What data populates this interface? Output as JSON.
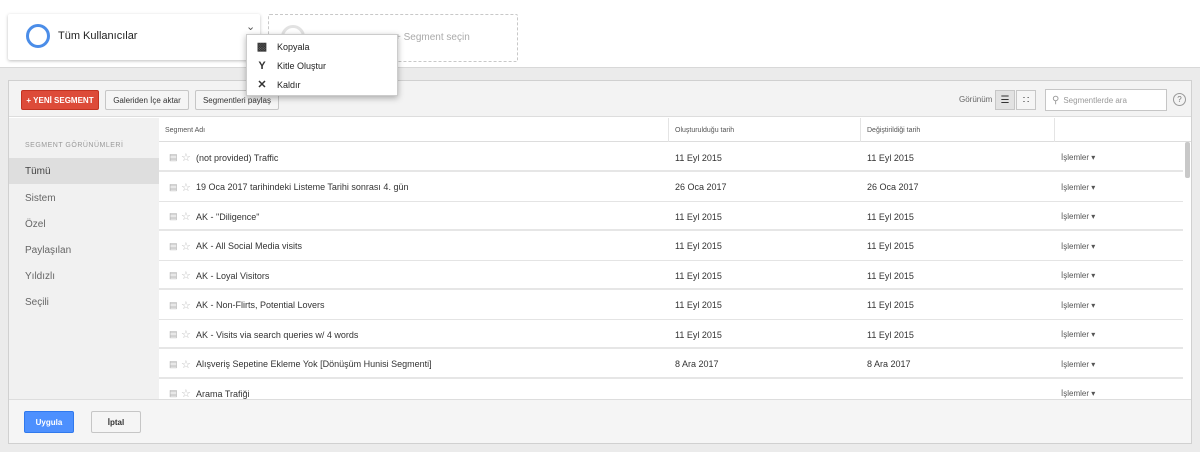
{
  "segment_bar": {
    "active_segment": "Tüm Kullanıcılar",
    "add_segment_text": "+ Segment seçin"
  },
  "menu": {
    "items": [
      {
        "label": "Kopyala",
        "icon": "copy-icon"
      },
      {
        "label": "Kitle Oluştur",
        "icon": "audience-icon"
      },
      {
        "label": "Kaldır",
        "icon": "close-icon"
      }
    ]
  },
  "toolbar": {
    "new_segment": "+ YENİ SEGMENT",
    "import_gallery": "Galeriden İçe aktar",
    "share_segments": "Segmentleri paylaş",
    "view_label": "Görünüm",
    "search_placeholder": "Segmentlerde ara",
    "help": "?"
  },
  "sidebar": {
    "heading": "SEGMENT GÖRÜNÜMLERİ",
    "items": [
      "Tümü",
      "Sistem",
      "Özel",
      "Paylaşılan",
      "Yıldızlı",
      "Seçili"
    ]
  },
  "table": {
    "columns": [
      "Segment Adı",
      "Oluşturulduğu tarih",
      "Değiştirildiği tarih",
      ""
    ],
    "actions_label": "İşlemler ▾",
    "rows": [
      {
        "name": "(not provided) Traffic",
        "created": "11 Eyl 2015",
        "modified": "11 Eyl 2015"
      },
      {
        "name": "19 Oca 2017 tarihindeki Listeme Tarihi sonrası 4. gün",
        "created": "26 Oca 2017",
        "modified": "26 Oca 2017"
      },
      {
        "name": "AK - \"Diligence\"",
        "created": "11 Eyl 2015",
        "modified": "11 Eyl 2015"
      },
      {
        "name": "AK - All Social Media visits",
        "created": "11 Eyl 2015",
        "modified": "11 Eyl 2015"
      },
      {
        "name": "AK - Loyal Visitors",
        "created": "11 Eyl 2015",
        "modified": "11 Eyl 2015"
      },
      {
        "name": "AK - Non-Flirts, Potential Lovers",
        "created": "11 Eyl 2015",
        "modified": "11 Eyl 2015"
      },
      {
        "name": "AK - Visits via search queries w/ 4 words",
        "created": "11 Eyl 2015",
        "modified": "11 Eyl 2015"
      },
      {
        "name": "Alışveriş Sepetine Ekleme Yok [Dönüşüm Hunisi Segmenti]",
        "created": "8 Ara 2017",
        "modified": "8 Ara 2017"
      },
      {
        "name": "Arama Trafiği",
        "created": "",
        "modified": ""
      }
    ]
  },
  "footer": {
    "apply": "Uygula",
    "cancel": "İptal"
  },
  "colors": {
    "new_segment_red": "#dd4b39",
    "apply_blue": "#4d90fe",
    "segment_ring_blue": "#4b8de8"
  }
}
